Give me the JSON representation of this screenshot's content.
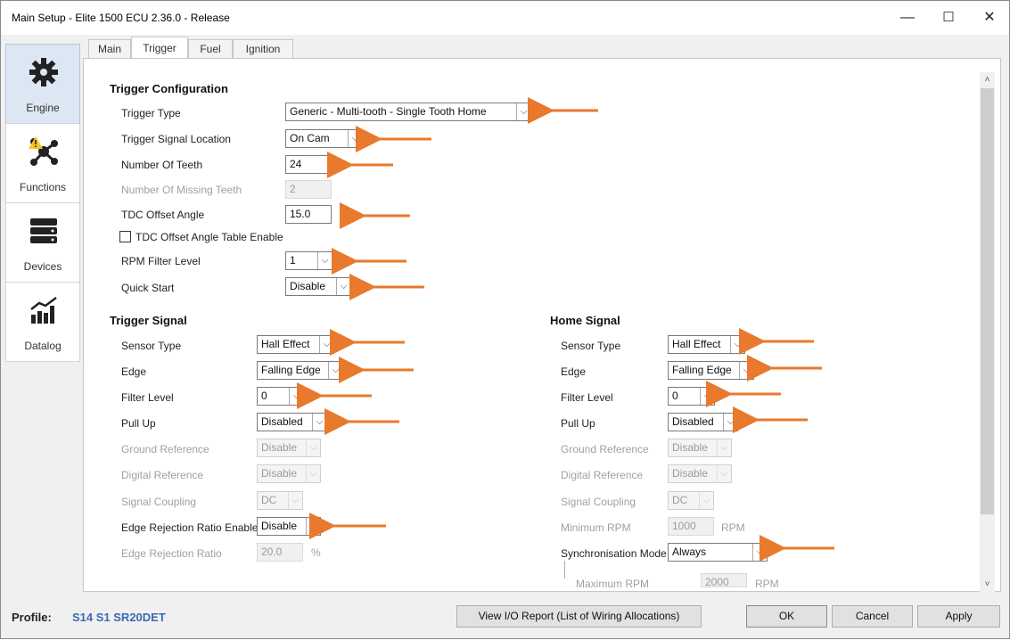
{
  "window": {
    "title": "Main Setup - Elite 1500 ECU 2.36.0 - Release",
    "min_glyph": "—",
    "max_glyph": "☐",
    "close_glyph": "✕"
  },
  "sidebar": {
    "items": [
      {
        "label": "Engine",
        "icon": "gear-icon",
        "active": true
      },
      {
        "label": "Functions",
        "icon": "network-icon",
        "warning": true
      },
      {
        "label": "Devices",
        "icon": "server-stack-icon"
      },
      {
        "label": "Datalog",
        "icon": "bar-chart-icon"
      }
    ]
  },
  "tabs": [
    {
      "label": "Main"
    },
    {
      "label": "Trigger",
      "active": true
    },
    {
      "label": "Fuel"
    },
    {
      "label": "Ignition"
    }
  ],
  "trigger_config": {
    "title": "Trigger Configuration",
    "trigger_type": {
      "label": "Trigger Type",
      "value": "Generic - Multi-tooth - Single Tooth Home"
    },
    "signal_location": {
      "label": "Trigger Signal Location",
      "value": "On Cam"
    },
    "num_teeth": {
      "label": "Number Of Teeth",
      "value": "24"
    },
    "missing_teeth": {
      "label": "Number Of Missing Teeth",
      "value": "2"
    },
    "tdc_offset": {
      "label": "TDC Offset Angle",
      "value": "15.0",
      "unit": "°"
    },
    "tdc_table": {
      "label": "TDC Offset Angle Table Enable",
      "checked": false
    },
    "rpm_filter": {
      "label": "RPM Filter Level",
      "value": "1"
    },
    "quick_start": {
      "label": "Quick Start",
      "value": "Disable"
    }
  },
  "trigger_signal": {
    "title": "Trigger Signal",
    "sensor_type": {
      "label": "Sensor Type",
      "value": "Hall Effect"
    },
    "edge": {
      "label": "Edge",
      "value": "Falling Edge"
    },
    "filter_level": {
      "label": "Filter Level",
      "value": "0"
    },
    "pull_up": {
      "label": "Pull Up",
      "value": "Disabled"
    },
    "ground_ref": {
      "label": "Ground Reference",
      "value": "Disable"
    },
    "digital_ref": {
      "label": "Digital Reference",
      "value": "Disable"
    },
    "coupling": {
      "label": "Signal Coupling",
      "value": "DC"
    },
    "edge_rej_enable": {
      "label": "Edge Rejection Ratio Enable",
      "value": "Disable"
    },
    "edge_rej_ratio": {
      "label": "Edge Rejection Ratio",
      "value": "20.0",
      "unit": "%"
    }
  },
  "home_signal": {
    "title": "Home Signal",
    "sensor_type": {
      "label": "Sensor Type",
      "value": "Hall Effect"
    },
    "edge": {
      "label": "Edge",
      "value": "Falling Edge"
    },
    "filter_level": {
      "label": "Filter Level",
      "value": "0"
    },
    "pull_up": {
      "label": "Pull Up",
      "value": "Disabled"
    },
    "ground_ref": {
      "label": "Ground Reference",
      "value": "Disable"
    },
    "digital_ref": {
      "label": "Digital Reference",
      "value": "Disable"
    },
    "coupling": {
      "label": "Signal Coupling",
      "value": "DC"
    },
    "min_rpm": {
      "label": "Minimum RPM",
      "value": "1000",
      "unit": "RPM"
    },
    "sync_mode": {
      "label": "Synchronisation Mode",
      "value": "Always"
    },
    "max_rpm": {
      "label": "Maximum RPM",
      "value": "2000",
      "unit": "RPM"
    }
  },
  "footer": {
    "profile_label": "Profile:",
    "profile_value": "S14 S1 SR20DET",
    "io_report": "View I/O Report (List of Wiring Allocations)",
    "ok": "OK",
    "cancel": "Cancel",
    "apply": "Apply"
  },
  "colors": {
    "annotation_arrow": "#e8792d",
    "profile_text": "#3a6ab5",
    "active_sidebar": "#dde7f3"
  },
  "dropdown_glyph": "⌵",
  "scroll_up_glyph": "˄",
  "scroll_down_glyph": "˅"
}
